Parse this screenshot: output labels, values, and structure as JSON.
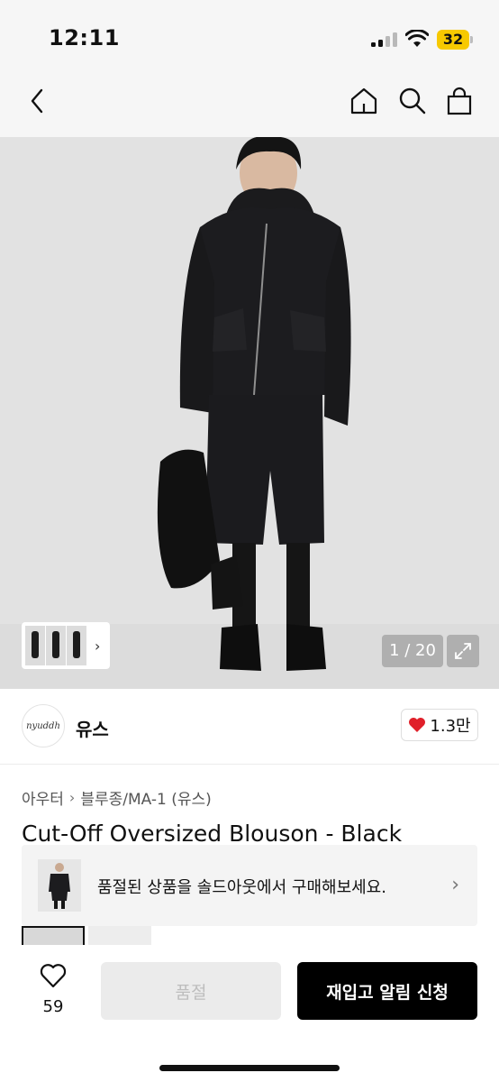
{
  "status_bar": {
    "time": "12:11",
    "battery": "32",
    "battery_color": "#f7c900"
  },
  "header": {
    "icons": [
      "back-icon",
      "home-icon",
      "search-icon",
      "shopping-bag-icon"
    ]
  },
  "gallery": {
    "counter": "1 / 20",
    "expand_icon": "expand-icon"
  },
  "brand": {
    "logo_text": "nyuddh",
    "name": "유스",
    "likes": "1.3만",
    "like_icon": "heart-icon",
    "like_color": "#e0202a"
  },
  "breadcrumb": {
    "items": [
      "아우터",
      "블루종/MA-1 (유스)"
    ]
  },
  "product": {
    "title": "Cut-Off Oversized Blouson - Black"
  },
  "soldout_banner": {
    "text": "품절된 상품을 솔드아웃에서 구매해보세요."
  },
  "bottom_bar": {
    "wish_count": "59",
    "soldout_label": "품절",
    "restock_label": "재입고 알림 신청"
  }
}
